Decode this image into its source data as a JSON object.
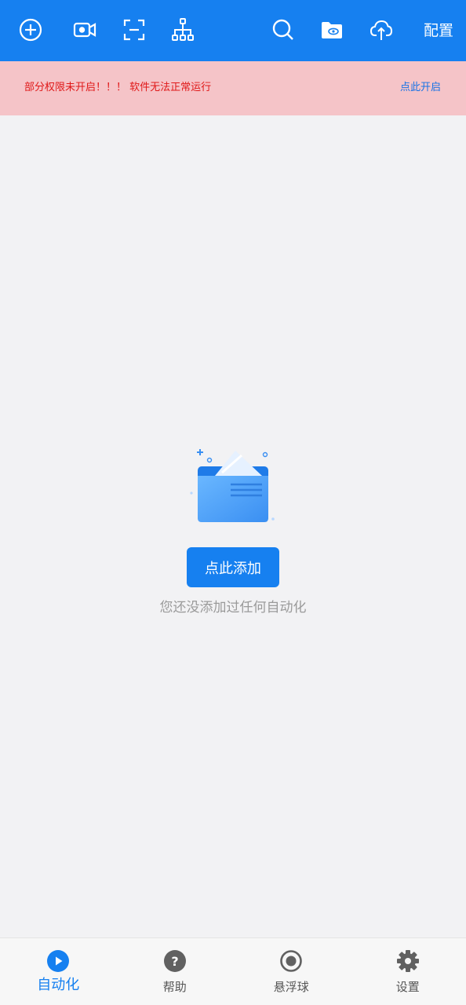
{
  "topbar": {
    "icons": [
      "add-circle-icon",
      "video-camera-icon",
      "scan-frame-icon",
      "hierarchy-icon",
      "search-icon",
      "folder-eye-icon",
      "cloud-upload-icon"
    ],
    "config_label": "配置",
    "background": "#1680f0"
  },
  "warning": {
    "text": "部分权限未开启！！！ 软件无法正常运行",
    "link_label": "点此开启",
    "background": "#f5c4c8",
    "text_color": "#e01818"
  },
  "empty_state": {
    "icon": "empty-folder-icon",
    "button_label": "点此添加",
    "message": "您还没添加过任何自动化"
  },
  "bottom_nav": {
    "items": [
      {
        "label": "自动化",
        "icon": "play-circle-icon",
        "active": true
      },
      {
        "label": "帮助",
        "icon": "help-icon",
        "active": false
      },
      {
        "label": "悬浮球",
        "icon": "record-icon",
        "active": false
      },
      {
        "label": "设置",
        "icon": "gear-icon",
        "active": false
      }
    ],
    "active_color": "#1680f0"
  }
}
